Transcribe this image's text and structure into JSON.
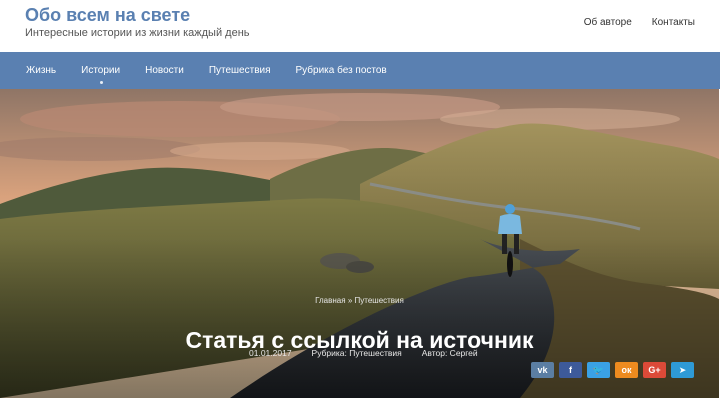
{
  "header": {
    "site_title": "Обо всем на свете",
    "site_description": "Интересные истории из жизни каждый день",
    "top_links": [
      "Об авторе",
      "Контакты"
    ]
  },
  "nav": {
    "items": [
      "Жизнь",
      "Истории",
      "Новости",
      "Путешествия",
      "Рубрика без постов"
    ]
  },
  "hero": {
    "breadcrumb": {
      "home": "Главная",
      "separator": "»",
      "category": "Путешествия"
    },
    "title": "Статья с ссылкой на источник",
    "meta": {
      "date": "01.01.2017",
      "category": "Рубрика: Путешествия",
      "author": "Автор: Сергей"
    }
  },
  "social": [
    {
      "name": "vk",
      "label": "vk",
      "icon": "vk-icon",
      "color": "#5b7ea3"
    },
    {
      "name": "facebook",
      "label": "f",
      "icon": "facebook-icon",
      "color": "#3d5a9a"
    },
    {
      "name": "twitter",
      "label": "🐦",
      "icon": "twitter-icon",
      "color": "#3aa1e5"
    },
    {
      "name": "odnoklassniki",
      "label": "ок",
      "icon": "odnoklassniki-icon",
      "color": "#ed8b1f"
    },
    {
      "name": "google-plus",
      "label": "G+",
      "icon": "google-plus-icon",
      "color": "#dc4a38"
    },
    {
      "name": "telegram",
      "label": "➤",
      "icon": "telegram-icon",
      "color": "#2e9ad6"
    }
  ],
  "colors": {
    "accent": "#5a80b1"
  }
}
